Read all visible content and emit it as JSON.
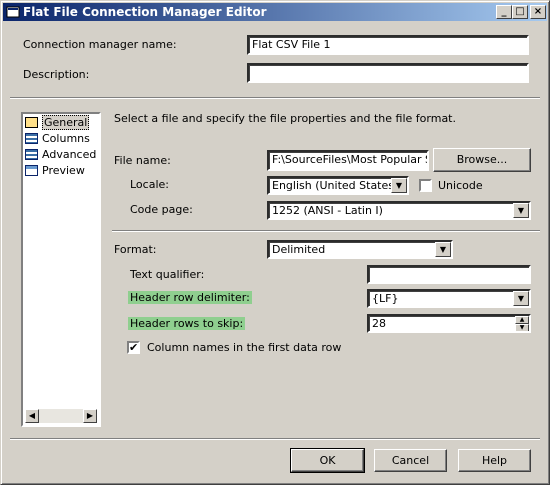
{
  "window": {
    "title": "Flat File Connection Manager Editor",
    "controls": {
      "minimize": "_",
      "maximize": "□",
      "close": "×"
    }
  },
  "top": {
    "name_label": "Connection manager name:",
    "name_value": "Flat CSV File 1",
    "description_label": "Description:",
    "description_value": ""
  },
  "nav": {
    "items": [
      {
        "label": "General",
        "icon": "general-icon"
      },
      {
        "label": "Columns",
        "icon": "columns-icon"
      },
      {
        "label": "Advanced",
        "icon": "advanced-icon"
      },
      {
        "label": "Preview",
        "icon": "preview-icon"
      }
    ],
    "selected": "General"
  },
  "general": {
    "intro": "Select a file and specify the file properties and the file format.",
    "file_name_label": "File name:",
    "file_name_value": "F:\\SourceFiles\\Most Popular Site",
    "browse_label": "Browse...",
    "locale_label": "Locale:",
    "locale_value": "English (United States)",
    "unicode_label": "Unicode",
    "unicode_checked": false,
    "code_page_label": "Code page:",
    "code_page_value": "1252  (ANSI - Latin I)",
    "format_label": "Format:",
    "format_value": "Delimited",
    "text_qualifier_label": "Text qualifier:",
    "text_qualifier_value": "",
    "header_row_delimiter_label": "Header row delimiter:",
    "header_row_delimiter_value": "{LF}",
    "header_rows_skip_label": "Header rows to skip:",
    "header_rows_skip_value": "28",
    "column_names_label": "Column names in the first data row",
    "column_names_checked": true,
    "highlight_color": "#8fcf8f"
  },
  "buttons": {
    "ok": "OK",
    "cancel": "Cancel",
    "help": "Help"
  }
}
